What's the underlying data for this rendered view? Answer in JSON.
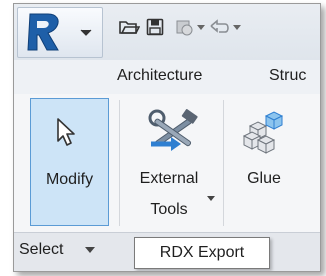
{
  "tabs": [
    "Architecture",
    "Struc"
  ],
  "ribbon": {
    "modify_label": "Modify",
    "external_tools_line1": "External",
    "external_tools_line2": "Tools",
    "glue_label": "Glue"
  },
  "panel": {
    "title": "Select"
  },
  "tooltip": {
    "text": "RDX Export"
  },
  "icons": {
    "app": "revit-r-logo-icon",
    "open": "folder-open-icon",
    "save": "save-disk-icon",
    "sync": "sync-icon",
    "undo": "undo-icon",
    "modify": "cursor-arrow-icon",
    "external_tools": "tools-wrench-hammer-icon",
    "glue": "glue-cubes-icon"
  },
  "colors": {
    "accent": "#cde4f7",
    "accent_border": "#5b9bd5",
    "logo_blue": "#1e5fa8"
  }
}
